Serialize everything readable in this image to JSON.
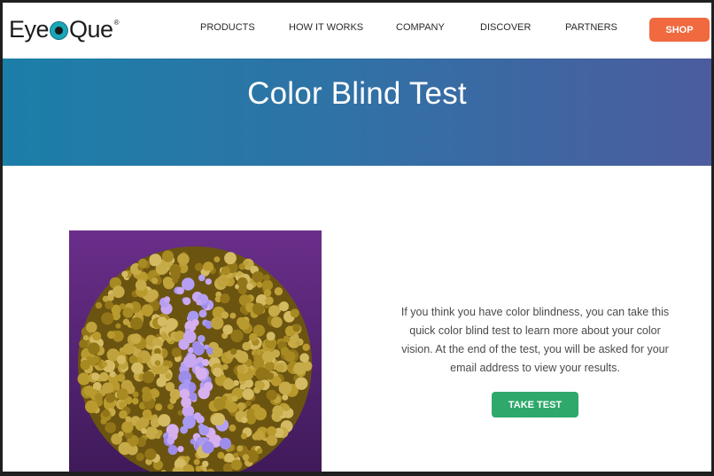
{
  "header": {
    "logo_text_pre": "Eye",
    "logo_text_post": "Que",
    "logo_mark": "®",
    "nav": [
      "PRODUCTS",
      "HOW IT WORKS",
      "COMPANY",
      "DISCOVER",
      "PARTNERS"
    ],
    "shop_label": "SHOP"
  },
  "hero": {
    "title": "Color Blind Test"
  },
  "main": {
    "plate_image": "ishihara-color-plate-digit-1",
    "description": "If you think you have color blindness, you can take this quick color blind test to learn more about your color vision. At the end of the test, you will be asked for your email address to view your results.",
    "cta_label": "TAKE TEST"
  },
  "colors": {
    "shop": "#f0693f",
    "cta": "#2ea96b",
    "hero_left": "#1b7fa8",
    "hero_right": "#4c5c9e",
    "plate_bg": "#5a2a7a"
  }
}
